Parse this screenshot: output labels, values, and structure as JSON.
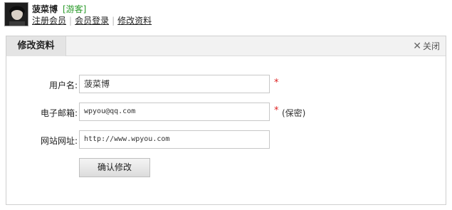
{
  "user": {
    "name": "菠菜博",
    "role": "[游客]",
    "links": [
      "注册会员",
      "会员登录",
      "修改资料"
    ],
    "separator": "|"
  },
  "panel": {
    "tab_title": "修改资料",
    "close_label": "关闭",
    "close_icon": "close-x-icon"
  },
  "form": {
    "username": {
      "label": "用户名:",
      "value": "菠菜博",
      "required_mark": "*"
    },
    "email": {
      "label": "电子邮箱:",
      "value": "wpyou@qq.com",
      "required_mark": "*",
      "note": "(保密)"
    },
    "website": {
      "label": "网站网址:",
      "value": "http://www.wpyou.com"
    },
    "submit_label": "确认修改"
  },
  "colors": {
    "role": "#2a9a2a",
    "required": "#dd2222",
    "panel_head": "#f2f2f2"
  }
}
